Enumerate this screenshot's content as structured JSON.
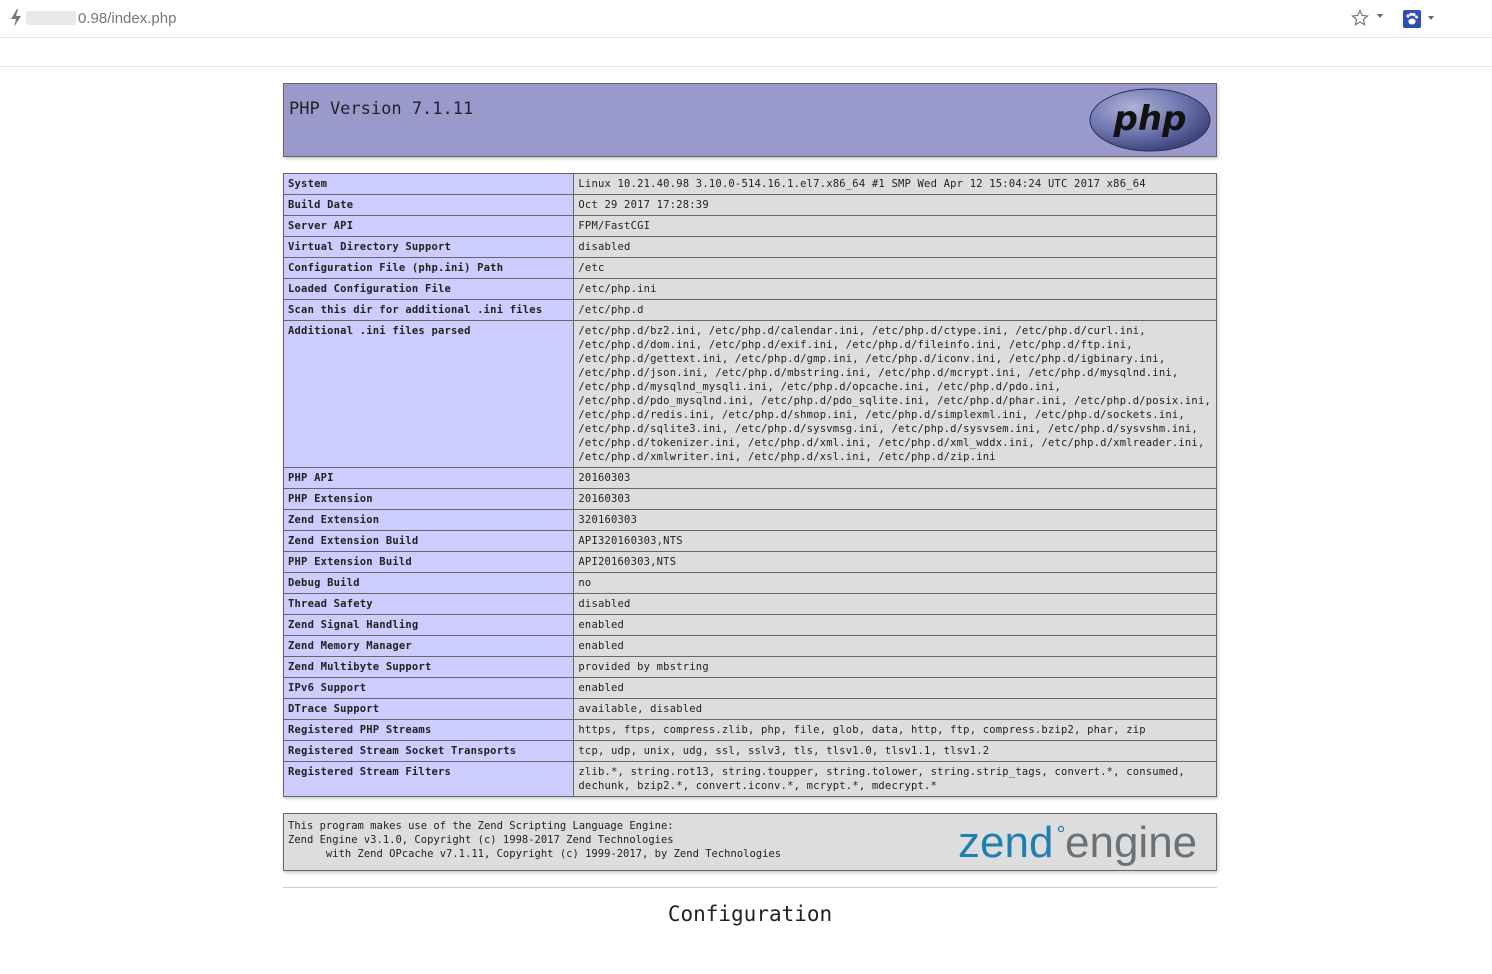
{
  "browser": {
    "url": "0.98/index.php",
    "accent": "#2d4fb8"
  },
  "header": {
    "title": "PHP Version 7.1.11",
    "logo_text": "php",
    "background": "#9999cc"
  },
  "info_rows": [
    {
      "label": "System",
      "value": "Linux 10.21.40.98 3.10.0-514.16.1.el7.x86_64 #1 SMP Wed Apr 12 15:04:24 UTC 2017 x86_64"
    },
    {
      "label": "Build Date",
      "value": "Oct 29 2017 17:28:39"
    },
    {
      "label": "Server API",
      "value": "FPM/FastCGI"
    },
    {
      "label": "Virtual Directory Support",
      "value": "disabled"
    },
    {
      "label": "Configuration File (php.ini) Path",
      "value": "/etc"
    },
    {
      "label": "Loaded Configuration File",
      "value": "/etc/php.ini"
    },
    {
      "label": "Scan this dir for additional .ini files",
      "value": "/etc/php.d"
    },
    {
      "label": "Additional .ini files parsed",
      "value": "/etc/php.d/bz2.ini, /etc/php.d/calendar.ini, /etc/php.d/ctype.ini, /etc/php.d/curl.ini,\n/etc/php.d/dom.ini, /etc/php.d/exif.ini, /etc/php.d/fileinfo.ini, /etc/php.d/ftp.ini,\n/etc/php.d/gettext.ini, /etc/php.d/gmp.ini, /etc/php.d/iconv.ini, /etc/php.d/igbinary.ini,\n/etc/php.d/json.ini, /etc/php.d/mbstring.ini, /etc/php.d/mcrypt.ini, /etc/php.d/mysqlnd.ini,\n/etc/php.d/mysqlnd_mysqli.ini, /etc/php.d/opcache.ini, /etc/php.d/pdo.ini,\n/etc/php.d/pdo_mysqlnd.ini, /etc/php.d/pdo_sqlite.ini, /etc/php.d/phar.ini, /etc/php.d/posix.ini,\n/etc/php.d/redis.ini, /etc/php.d/shmop.ini, /etc/php.d/simplexml.ini, /etc/php.d/sockets.ini,\n/etc/php.d/sqlite3.ini, /etc/php.d/sysvmsg.ini, /etc/php.d/sysvsem.ini, /etc/php.d/sysvshm.ini,\n/etc/php.d/tokenizer.ini, /etc/php.d/xml.ini, /etc/php.d/xml_wddx.ini, /etc/php.d/xmlreader.ini,\n/etc/php.d/xmlwriter.ini, /etc/php.d/xsl.ini, /etc/php.d/zip.ini",
      "multiline": true
    },
    {
      "label": "PHP API",
      "value": "20160303"
    },
    {
      "label": "PHP Extension",
      "value": "20160303"
    },
    {
      "label": "Zend Extension",
      "value": "320160303"
    },
    {
      "label": "Zend Extension Build",
      "value": "API320160303,NTS"
    },
    {
      "label": "PHP Extension Build",
      "value": "API20160303,NTS"
    },
    {
      "label": "Debug Build",
      "value": "no"
    },
    {
      "label": "Thread Safety",
      "value": "disabled"
    },
    {
      "label": "Zend Signal Handling",
      "value": "enabled"
    },
    {
      "label": "Zend Memory Manager",
      "value": "enabled"
    },
    {
      "label": "Zend Multibyte Support",
      "value": "provided by mbstring"
    },
    {
      "label": "IPv6 Support",
      "value": "enabled"
    },
    {
      "label": "DTrace Support",
      "value": "available, disabled"
    },
    {
      "label": "Registered PHP Streams",
      "value": "https, ftps, compress.zlib, php, file, glob, data, http, ftp, compress.bzip2, phar, zip"
    },
    {
      "label": "Registered Stream Socket Transports",
      "value": "tcp, udp, unix, udg, ssl, sslv3, tls, tlsv1.0, tlsv1.1, tlsv1.2"
    },
    {
      "label": "Registered Stream Filters",
      "value": "zlib.*, string.rot13, string.toupper, string.tolower, string.strip_tags, convert.*, consumed,\ndechunk, bzip2.*, convert.iconv.*, mcrypt.*, mdecrypt.*",
      "multiline": true
    }
  ],
  "zend": {
    "text": "This program makes use of the Zend Scripting Language Engine:\nZend Engine v3.1.0, Copyright (c) 1998-2017 Zend Technologies\n      with Zend OPcache v7.1.11, Copyright (c) 1999-2017, by Zend Technologies",
    "logo_left": "zend",
    "logo_right": "engine",
    "logo_color_left": "#1e7fb3",
    "logo_color_right": "#6a7278"
  },
  "section": {
    "title": "Configuration"
  }
}
